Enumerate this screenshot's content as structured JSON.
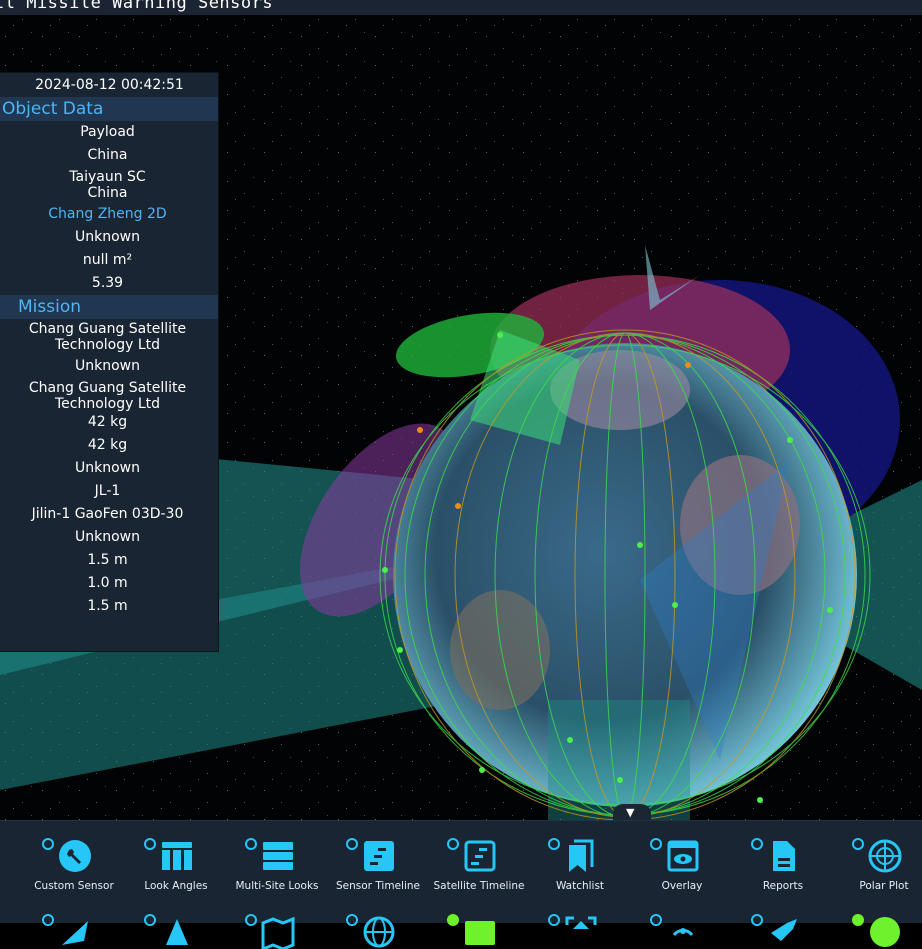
{
  "header": {
    "title": "ll Missile Warning Sensors"
  },
  "panel": {
    "timestamp": "2024-08-12 00:42:51",
    "object_data": {
      "heading": "Object Data",
      "rows": [
        "Payload",
        "China",
        "Taiyaun SC",
        "China",
        "Chang Zheng 2D",
        "Unknown",
        "null m²",
        "5.39"
      ]
    },
    "mission": {
      "heading": "Mission",
      "rows": [
        "Chang Guang Satellite",
        "Technology Ltd",
        "Unknown",
        "Chang Guang Satellite",
        "Technology Ltd",
        "42 kg",
        "42 kg",
        "Unknown",
        "JL-1",
        "Jilin-1 GaoFen 03D-30",
        "Unknown",
        "1.5 m",
        "1.0 m",
        "1.5 m"
      ]
    }
  },
  "scene": {
    "collapse_glyph": "▼"
  },
  "toolbar": {
    "accent": "#26c6f6",
    "active": "#6df22b",
    "row1": [
      {
        "label": "Custom Sensor",
        "icon": "wrench-icon",
        "active": false
      },
      {
        "label": "Look Angles",
        "icon": "table-icon",
        "active": false
      },
      {
        "label": "Multi-Site Looks",
        "icon": "list-icon",
        "active": false
      },
      {
        "label": "Sensor Timeline",
        "icon": "timeline-icon",
        "active": false
      },
      {
        "label": "Satellite Timeline",
        "icon": "timeline-outline-icon",
        "active": false
      },
      {
        "label": "Watchlist",
        "icon": "bookmark-icon",
        "active": false
      },
      {
        "label": "Overlay",
        "icon": "eye-window-icon",
        "active": false
      },
      {
        "label": "Reports",
        "icon": "document-icon",
        "active": false
      },
      {
        "label": "Polar Plot",
        "icon": "radar-icon",
        "active": false
      }
    ],
    "row2": [
      {
        "icon": "rocket-icon",
        "active": false
      },
      {
        "icon": "triangle-icon",
        "active": false
      },
      {
        "icon": "map-icon",
        "active": false
      },
      {
        "icon": "globe-icon",
        "active": false
      },
      {
        "icon": "card-icon",
        "active": true
      },
      {
        "icon": "frame-icon",
        "active": false
      },
      {
        "icon": "broadcast-icon",
        "active": false
      },
      {
        "icon": "satellite-icon",
        "active": false
      },
      {
        "icon": "earth-icon",
        "active": true
      }
    ]
  }
}
